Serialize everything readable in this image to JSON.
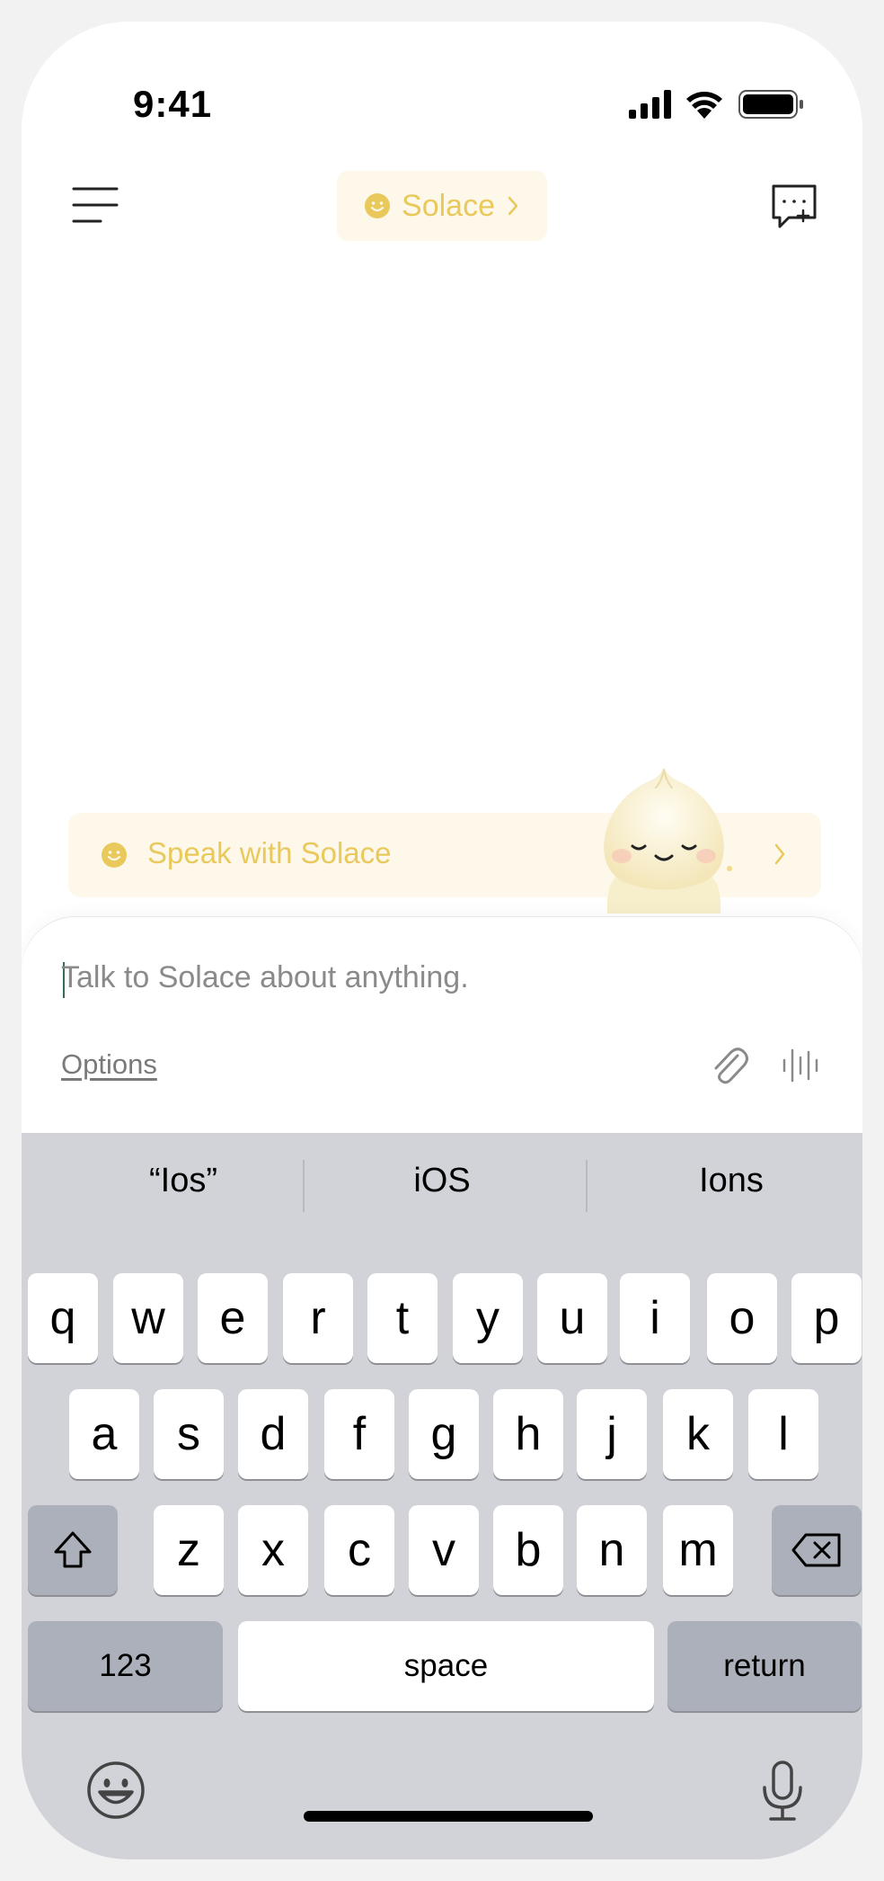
{
  "status_bar": {
    "time": "9:41"
  },
  "header": {
    "title": "Solace"
  },
  "speak_banner": {
    "label": "Speak with Solace"
  },
  "composer": {
    "placeholder": "Talk to Solace about anything.",
    "options_label": "Options"
  },
  "keyboard": {
    "suggestions": [
      "“Ios”",
      "iOS",
      "Ions"
    ],
    "row1": [
      "q",
      "w",
      "e",
      "r",
      "t",
      "y",
      "u",
      "i",
      "o",
      "p"
    ],
    "row2": [
      "a",
      "s",
      "d",
      "f",
      "g",
      "h",
      "j",
      "k",
      "l"
    ],
    "row3": [
      "z",
      "x",
      "c",
      "v",
      "b",
      "n",
      "m"
    ],
    "numbers_label": "123",
    "space_label": "space",
    "return_label": "return"
  },
  "colors": {
    "accent": "#e9c95c",
    "accent_bg": "#fdf8ea",
    "keyboard_bg": "#d1d3d9"
  },
  "icons": [
    "menu-icon",
    "smiley-icon",
    "chevron-right-icon",
    "new-chat-icon",
    "paperclip-icon",
    "voice-waveform-icon",
    "shift-icon",
    "backspace-icon",
    "emoji-icon",
    "microphone-icon"
  ]
}
